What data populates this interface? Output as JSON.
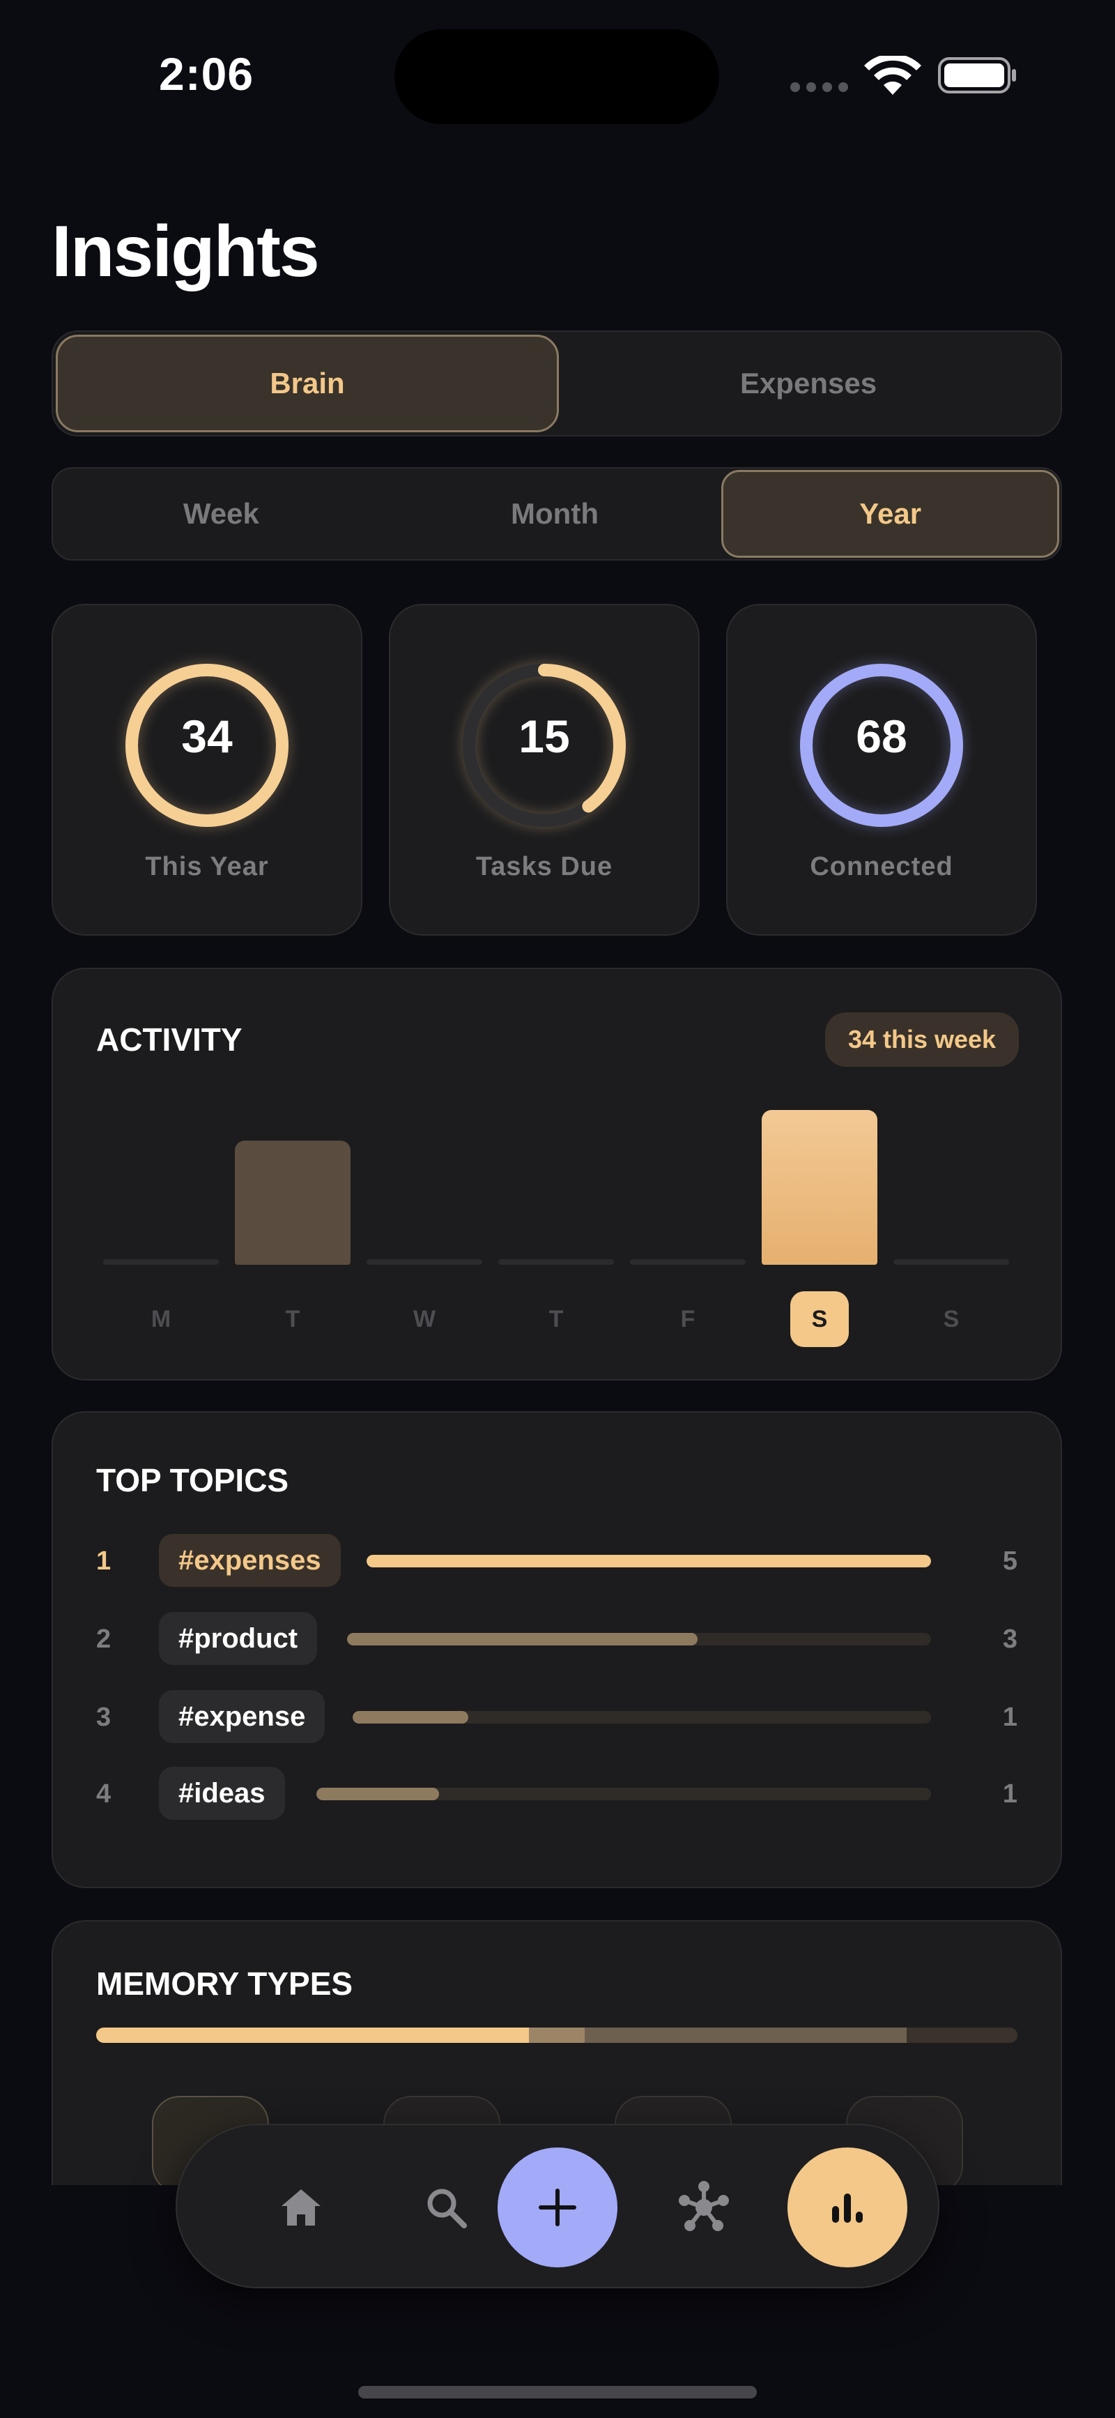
{
  "status": {
    "time": "2:06"
  },
  "page": {
    "title": "Insights"
  },
  "tabs": [
    {
      "label": "Brain",
      "active": true
    },
    {
      "label": "Expenses",
      "active": false
    }
  ],
  "periods": [
    {
      "label": "Week",
      "active": false
    },
    {
      "label": "Month",
      "active": false
    },
    {
      "label": "Year",
      "active": true
    }
  ],
  "stats": [
    {
      "value": "34",
      "label": "This Year",
      "progress": 1.0,
      "color": "#f6cf94"
    },
    {
      "value": "15",
      "label": "Tasks Due",
      "progress": 0.4,
      "color": "#f6cf94"
    },
    {
      "value": "68",
      "label": "Connected",
      "progress": 1.0,
      "color": "#a3aaf8"
    }
  ],
  "activity": {
    "title": "ACTIVITY",
    "badge": "34 this week",
    "colors": {
      "bar": "#5a4d40",
      "bar_active": "#f3c889"
    }
  },
  "chart_data": {
    "type": "bar",
    "categories": [
      "M",
      "T",
      "W",
      "T",
      "F",
      "S",
      "S"
    ],
    "values": [
      0,
      8,
      0,
      0,
      0,
      10,
      0
    ],
    "active_index": 5
  },
  "topics": {
    "title": "TOP TOPICS",
    "items": [
      {
        "rank": "1",
        "tag": "#expenses",
        "count": "5",
        "value": 5
      },
      {
        "rank": "2",
        "tag": "#product",
        "count": "3",
        "value": 3
      },
      {
        "rank": "3",
        "tag": "#expense",
        "count": "1",
        "value": 1
      },
      {
        "rank": "4",
        "tag": "#ideas",
        "count": "1",
        "value": 1
      }
    ]
  },
  "memory": {
    "title": "MEMORY TYPES",
    "shares": [
      0.47,
      0.06,
      0.35,
      0.12
    ],
    "colors": [
      "#f3c889",
      "#9c8566",
      "#6e604f",
      "#3a332b"
    ]
  },
  "nav": {
    "items": [
      "home-icon",
      "search-icon",
      "plus-icon",
      "graph-icon",
      "chart-icon"
    ],
    "accent": "#a3aaf8",
    "active_color": "#f3c889"
  }
}
